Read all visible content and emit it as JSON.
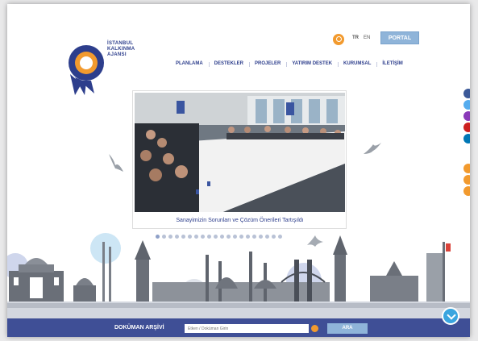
{
  "header": {
    "logo_lines": [
      "İSTANBUL",
      "KALKINMA",
      "AJANSI"
    ],
    "lang_tr": "TR",
    "lang_en": "EN",
    "portal_label": "PORTAL"
  },
  "nav": {
    "items": [
      "PLANLAMA",
      "DESTEKLER",
      "PROJELER",
      "YATIRIM DESTEK",
      "KURUMSAL",
      "İLETİŞİM"
    ]
  },
  "slider": {
    "caption": "Sanayimizin Sorunları ve Çözüm Önerileri Tartışıldı",
    "slide_count": 20,
    "active_slide": 1
  },
  "social": {
    "icons": [
      {
        "name": "facebook-icon",
        "color": "#3b5998"
      },
      {
        "name": "twitter-icon",
        "color": "#55acee"
      },
      {
        "name": "instagram-icon",
        "color": "#8a3ab9"
      },
      {
        "name": "youtube-icon",
        "color": "#cd201f"
      },
      {
        "name": "linkedin-icon",
        "color": "#0077b5"
      },
      {
        "name": "rss-icon",
        "color": "#f29a2e"
      },
      {
        "name": "mail-icon",
        "color": "#f29a2e"
      },
      {
        "name": "phone-icon",
        "color": "#f29a2e"
      }
    ]
  },
  "archive": {
    "label": "DOKÜMAN ARŞİVİ",
    "placeholder": "Etken / Doküman Girin",
    "button_label": "ARA"
  },
  "colors": {
    "brand_navy": "#2d3e8c",
    "accent_orange": "#f29a2e",
    "light_blue": "#8fb4d9",
    "bar_blue": "#3f4f96"
  }
}
